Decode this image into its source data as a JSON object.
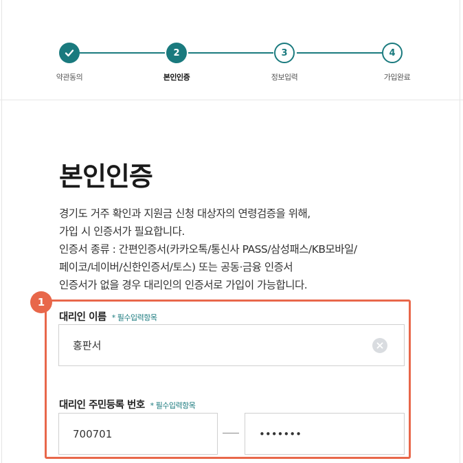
{
  "steps": [
    {
      "label": "약관동의",
      "number": "",
      "state": "done"
    },
    {
      "label": "본인인증",
      "number": "2",
      "state": "active"
    },
    {
      "label": "정보입력",
      "number": "3",
      "state": "todo"
    },
    {
      "label": "가입완료",
      "number": "4",
      "state": "todo"
    }
  ],
  "page_title": "본인인증",
  "description": [
    "경기도 거주 확인과 지원금 신청 대상자의 연령검증을 위해,",
    "가입 시 인증서가 필요합니다.",
    "인증서 종류 : 간편인증서(카카오톡/통신사 PASS/삼성패스/KB모바일/",
    "페이코/네이버/신한인증서/토스) 또는 공동·금융 인증서",
    "인증서가 없을 경우 대리인의 인증서로 가입이 가능합니다."
  ],
  "annotation_badge": "1",
  "form": {
    "name_label": "대리인 이름",
    "required_tag": "* 필수입력항목",
    "name_value": "홍판서",
    "rrn_label": "대리인 주민등록 번호",
    "rrn_front_value": "700701",
    "rrn_back_value": "•••••••"
  },
  "colors": {
    "accent": "#1a7a7e",
    "highlight": "#e8674a"
  }
}
